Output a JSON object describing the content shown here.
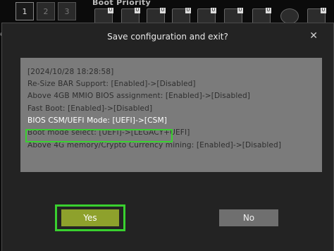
{
  "background": {
    "tabs": [
      "1",
      "2",
      "3"
    ],
    "boot_priority_label": "Boot Priority",
    "boot_device_badge": "U",
    "left_letter": "e"
  },
  "dialog": {
    "title": "Save configuration and exit?",
    "close_glyph": "✕",
    "lines": [
      "[2024/10/28 18:28:58]",
      "Re-Size BAR Support: [Enabled]->[Disabled]",
      "Above 4GB MMIO BIOS assignment: [Enabled]->[Disabled]",
      "Fast Boot: [Enabled]->[Disabled]",
      "BIOS CSM/UEFI Mode: [UEFI]->[CSM]",
      "Boot mode select: [UEFI]->[LEGACY+UEFI]",
      "Above 4G memory/Crypto Currency mining: [Enabled]->[Disabled]"
    ],
    "yes_label": "Yes",
    "no_label": "No"
  },
  "colors": {
    "highlight_green": "#39d02f",
    "yes_button": "#8ea12c",
    "no_button": "#6f6f6f",
    "message_box": "#7b7b7b"
  }
}
